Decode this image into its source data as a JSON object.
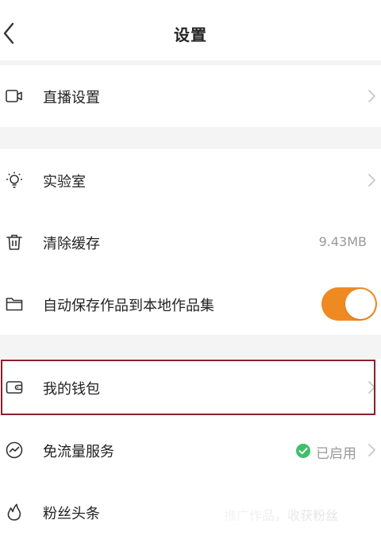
{
  "header": {
    "title": "设置"
  },
  "sections": {
    "live": {
      "label": "直播设置",
      "icon": "video-camera-icon"
    },
    "lab": {
      "label": "实验室",
      "icon": "lightbulb-icon"
    },
    "cache": {
      "label": "清除缓存",
      "icon": "trash-icon",
      "value": "9.43MB"
    },
    "autosave": {
      "label": "自动保存作品到本地作品集",
      "icon": "folder-icon",
      "toggle_on": true
    },
    "wallet": {
      "label": "我的钱包",
      "icon": "wallet-icon"
    },
    "free_data": {
      "label": "免流量服务",
      "icon": "gauge-icon",
      "status": "已启用"
    },
    "fans": {
      "label": "粉丝头条",
      "icon": "flame-icon",
      "value": "推广作品，收获粉丝"
    }
  },
  "colors": {
    "accent": "#ef8a22",
    "status_green": "#3ec06b",
    "highlight_border": "#8b1f2a",
    "section_gap": "#f4f4f4"
  }
}
